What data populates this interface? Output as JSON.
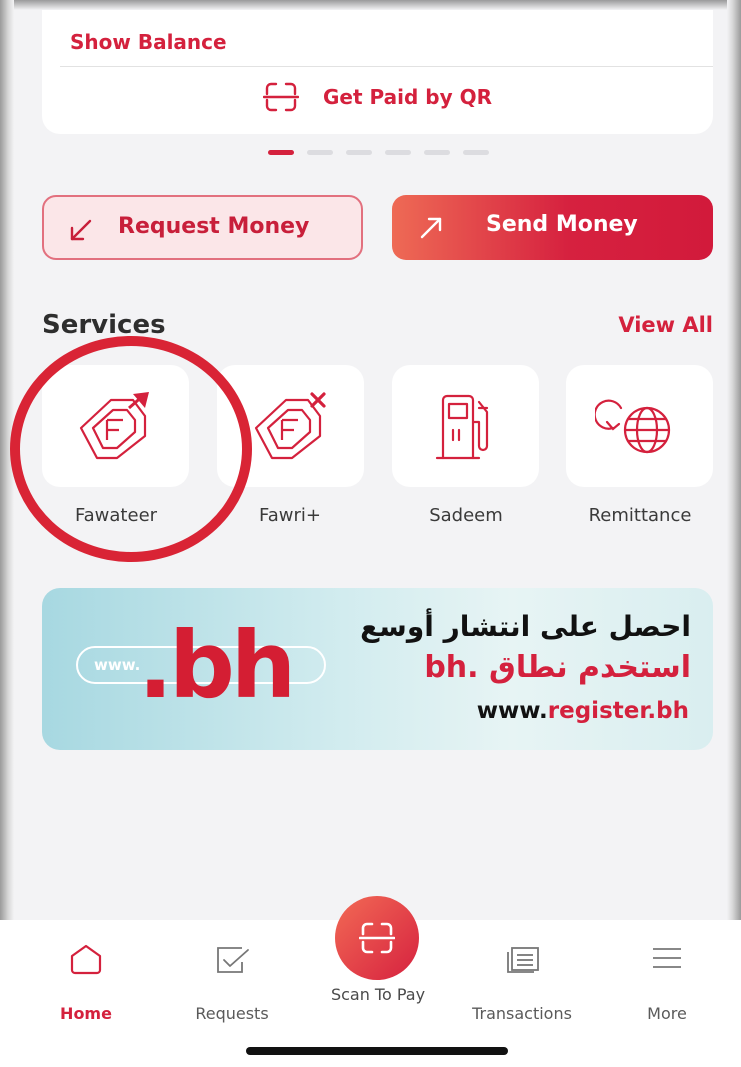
{
  "balance_card": {
    "show_balance": "Show Balance",
    "get_paid_qr": "Get Paid by QR"
  },
  "carousel": {
    "total_pages": 6,
    "active_page": 1
  },
  "actions": {
    "request_money": "Request Money",
    "send_money": "Send Money"
  },
  "services": {
    "title": "Services",
    "view_all": "View All",
    "items": [
      {
        "label": "Fawateer",
        "icon": "fawateer-icon"
      },
      {
        "label": "Fawri+",
        "icon": "fawri-plus-icon"
      },
      {
        "label": "Sadeem",
        "icon": "fuel-pump-icon"
      },
      {
        "label": "Remittance",
        "icon": "globe-transfer-icon"
      }
    ]
  },
  "banner": {
    "url_hint": "www.",
    "brand": ".bh",
    "arabic_line1": "احصل على انتشار أوسع",
    "arabic_line2": "استخدم نطاق .bh",
    "website_prefix": "www.",
    "website_domain": "register.bh"
  },
  "tabbar": {
    "home": "Home",
    "requests": "Requests",
    "scan": "Scan To Pay",
    "transactions": "Transactions",
    "more": "More"
  },
  "colors": {
    "accent": "#d4213d",
    "highlight_ring": "#d92435",
    "banner_bg": "#cfe9ed"
  }
}
